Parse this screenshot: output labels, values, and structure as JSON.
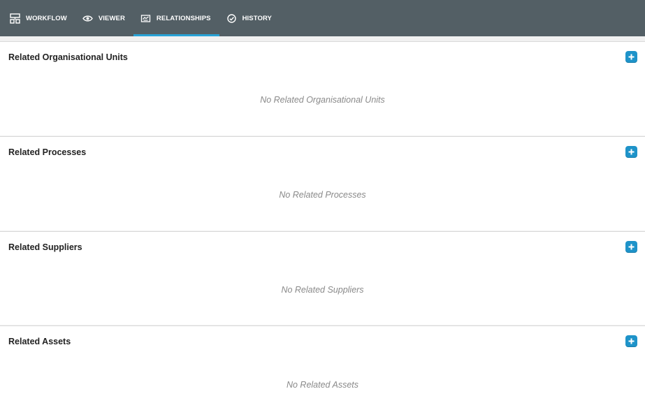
{
  "tabs": [
    {
      "label": "WORKFLOW",
      "icon": "workflow-icon"
    },
    {
      "label": "VIEWER",
      "icon": "eye-icon"
    },
    {
      "label": "RELATIONSHIPS",
      "icon": "handshake-icon",
      "active": true
    },
    {
      "label": "HISTORY",
      "icon": "history-icon"
    }
  ],
  "sections": [
    {
      "title": "Related Organisational Units",
      "empty": "No Related Organisational Units"
    },
    {
      "title": "Related Processes",
      "empty": "No Related Processes"
    },
    {
      "title": "Related Suppliers",
      "empty": "No Related Suppliers"
    },
    {
      "title": "Related Assets",
      "empty": "No Related Assets"
    }
  ],
  "colors": {
    "topbar": "#535f65",
    "active_underline": "#29a3d6",
    "add_button": "#1e93c9"
  }
}
